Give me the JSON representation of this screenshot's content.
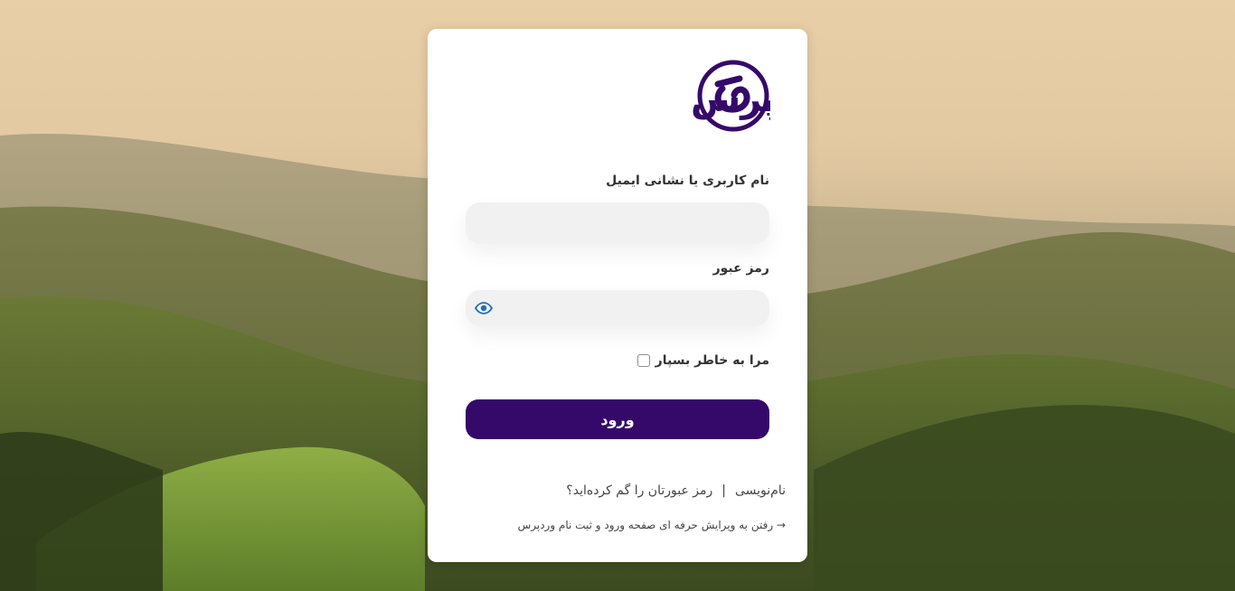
{
  "brand": {
    "logo_text": "گراف وردپرس",
    "accent_color": "#35096a"
  },
  "form": {
    "username_label": "نام کاربری یا نشانی ایمیل",
    "username_value": "",
    "password_label": "رمز عبور",
    "password_value": "",
    "show_password_icon": "eye-icon",
    "remember_label": "مرا به خاطر بسپار",
    "remember_checked": false,
    "submit_label": "ورود"
  },
  "links": {
    "register": "نام‌نویسی",
    "separator": "|",
    "lost_password": "رمز عبورتان را گم کرده‌اید؟",
    "back_to_editor": "→ رفتن به ویرایش حرفه ای صفحه ورود و ثبت نام وردپرس"
  }
}
